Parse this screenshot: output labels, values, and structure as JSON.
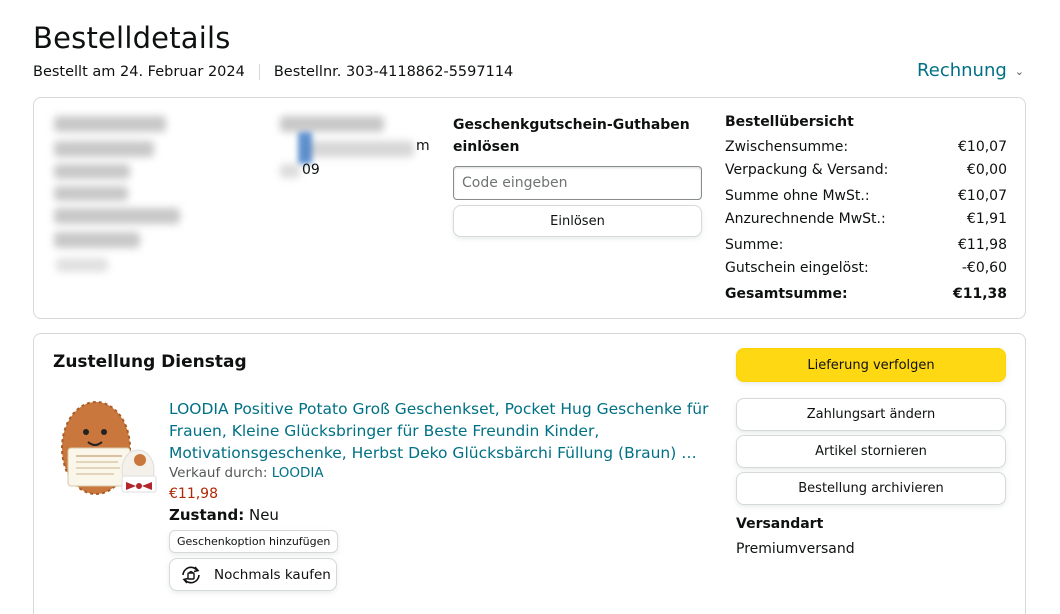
{
  "header": {
    "title": "Bestelldetails",
    "ordered_on": "Bestellt am 24. Februar 2024",
    "order_number": "Bestellnr. 303-4118862-5597114",
    "invoice_label": "Rechnung",
    "invoice_icon": "chevron-down-icon"
  },
  "address": {
    "fragments": [
      "m",
      "09"
    ]
  },
  "gift_card": {
    "title": "Geschenkgutschein-Guthaben einlösen",
    "placeholder": "Code eingeben",
    "button_label": "Einlösen"
  },
  "summary": {
    "title": "Bestellübersicht",
    "rows": [
      {
        "label": "Zwischensumme:",
        "value": "€10,07"
      },
      {
        "label": "Verpackung & Versand:",
        "value": "€0,00"
      },
      {
        "label": "Summe ohne MwSt.:",
        "value": "€10,07"
      },
      {
        "label": "Anzurechnende MwSt.:",
        "value": "€1,91"
      },
      {
        "label": "Summe:",
        "value": "€11,98"
      },
      {
        "label": "Gutschein eingelöst:",
        "value": "-€0,60"
      }
    ],
    "total": {
      "label": "Gesamtsumme:",
      "value": "€11,38"
    }
  },
  "delivery": {
    "title": "Zustellung Dienstag",
    "product": {
      "name": "LOODIA Positive Potato Groß Geschenkset, Pocket Hug Geschenke für Frauen, Kleine Glücksbringer für Beste Freundin Kinder, Motivationsgeschenke, Herbst Deko Glücksbärchi Füllung (Braun) …",
      "seller_prefix": "Verkauf durch:",
      "seller": "LOODIA",
      "price": "€11,98",
      "condition_label": "Zustand:",
      "condition_value": "Neu",
      "gift_option_label": "Geschenkoption hinzufügen",
      "buy_again_label": "Nochmals kaufen",
      "buy_again_icon": "reorder-icon"
    },
    "actions": {
      "track": "Lieferung verfolgen",
      "change_payment": "Zahlungsart ändern",
      "cancel": "Artikel stornieren",
      "archive": "Bestellung archivieren"
    },
    "shipping": {
      "title": "Versandart",
      "value": "Premiumversand"
    }
  },
  "colors": {
    "link": "#007185",
    "price": "#b12704",
    "primary_button": "#ffd814",
    "border": "#d5d9d9"
  }
}
